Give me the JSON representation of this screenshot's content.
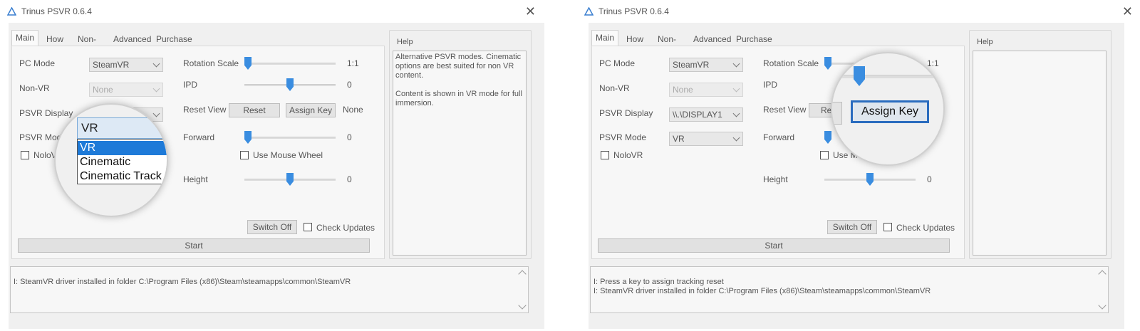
{
  "colors": {
    "accent": "#3a8de0",
    "selection": "#1e7ad8",
    "focus_border": "#2a6cbf"
  },
  "left": {
    "title": "Trinus PSVR 0.6.4",
    "tabs": [
      "Main",
      "How to",
      "Non-VR",
      "Advanced",
      "Purchase"
    ],
    "pc_mode_label": "PC Mode",
    "pc_mode_value": "SteamVR",
    "nonvr_label": "Non-VR",
    "nonvr_value": "None",
    "display_label": "PSVR Display",
    "mode_label": "PSVR Mode",
    "nolovr_label": "NoloVR",
    "rotation_label": "Rotation Scale",
    "rotation_value": "1:1",
    "ipd_label": "IPD",
    "ipd_value": "0",
    "reset_view_label": "Reset View",
    "reset_button": "Reset",
    "assign_key_button": "Assign Key",
    "assign_key_value": "None",
    "forward_label": "Forward",
    "forward_value": "0",
    "mouse_wheel_label": "Use Mouse Wheel",
    "height_label": "Height",
    "height_value": "0",
    "switch_off_button": "Switch Off",
    "check_updates_label": "Check Updates",
    "start_button": "Start",
    "help_label": "Help",
    "help_text": "Alternative PSVR modes. Cinematic options are best suited for non VR content.\n\nContent is shown in VR mode for full immersion.",
    "log_text": "I: SteamVR driver installed in folder C:\\Program Files (x86)\\Steam\\steamapps\\common\\SteamVR",
    "magnifier": {
      "selected": "VR",
      "options": [
        "VR",
        "Cinematic",
        "Cinematic Track"
      ]
    }
  },
  "right": {
    "title": "Trinus PSVR 0.6.4",
    "tabs": [
      "Main",
      "How to",
      "Non-VR",
      "Advanced",
      "Purchase"
    ],
    "pc_mode_label": "PC Mode",
    "pc_mode_value": "SteamVR",
    "nonvr_label": "Non-VR",
    "nonvr_value": "None",
    "display_label": "PSVR Display",
    "display_value": "\\\\.\\DISPLAY1",
    "mode_label": "PSVR Mode",
    "mode_value": "VR",
    "nolovr_label": "NoloVR",
    "rotation_label": "Rotation Scale",
    "rotation_value": "1:1",
    "ipd_label": "IPD",
    "reset_view_label": "Reset View",
    "reset_partial": "Re",
    "forward_label": "Forward",
    "mouse_wheel_partial": "Use Mo",
    "height_label": "Height",
    "height_value": "0",
    "switch_off_button": "Switch Off",
    "check_updates_label": "Check Updates",
    "start_button": "Start",
    "help_label": "Help",
    "log_text": "I: Press a key to assign tracking reset\nI: SteamVR driver installed in folder C:\\Program Files (x86)\\Steam\\steamapps\\common\\SteamVR",
    "magnifier": {
      "assign_key_button": "Assign Key"
    }
  }
}
